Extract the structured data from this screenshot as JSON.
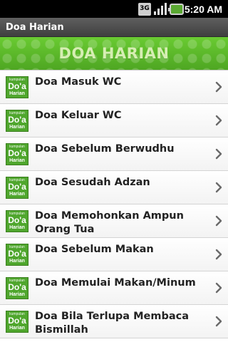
{
  "status": {
    "network": "3G",
    "time": "5:20 AM"
  },
  "title": "Doa Harian",
  "banner": "DOA HARIAN",
  "logo": {
    "line1": "kumpulan",
    "line2": "Do'a",
    "line3": "Harian"
  },
  "items": [
    "Doa Masuk WC",
    "Doa Keluar WC",
    "Doa Sebelum Berwudhu",
    "Doa Sesudah Adzan",
    "Doa Memohonkan Ampun Orang Tua",
    "Doa Sebelum Makan",
    "Doa Memulai Makan/Minum",
    "Doa Bila Terlupa Membaca Bismillah"
  ],
  "colors": {
    "accent": "#5cb82a",
    "titlebar": "#4a4a4a"
  }
}
